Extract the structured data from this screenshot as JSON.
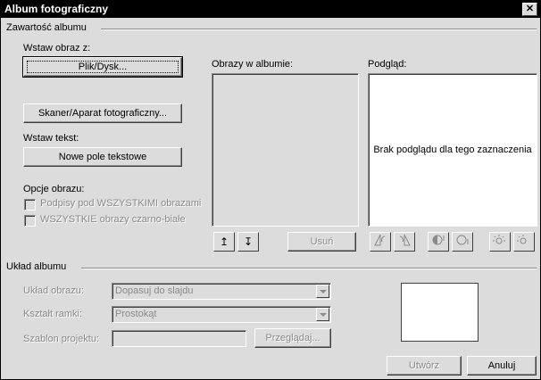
{
  "window": {
    "title": "Album fotograficzny"
  },
  "album_content": {
    "group_title": "Zawartość albumu",
    "insert_picture_label": "Wstaw obraz z:",
    "file_disk_button": "Plik/Dysk...",
    "scanner_button": "Skaner/Aparat fotograficzny...",
    "insert_text_label": "Wstaw tekst:",
    "new_textbox_button": "Nowe pole tekstowe",
    "picture_options_label": "Opcje obrazu:",
    "captions_checkbox": "Podpisy pod WSZYSTKIMI obrazami",
    "bw_checkbox": "WSZYSTKIE obrazy czarno-białe",
    "pictures_in_album_label": "Obrazy w albumie:",
    "move_up_glyph": "↥",
    "move_down_glyph": "↧",
    "remove_button": "Usuń",
    "preview_label": "Podgląd:",
    "preview_empty_text": "Brak podglądu dla tego zaznaczenia"
  },
  "album_layout": {
    "group_title": "Układ albumu",
    "picture_layout_label": "Układ obrazu:",
    "picture_layout_value": "Dopasuj do slajdu",
    "frame_shape_label": "Kształt ramki:",
    "frame_shape_value": "Prostokąt",
    "design_template_label": "Szablon projektu:",
    "design_template_value": "",
    "browse_button": "Przeglądaj..."
  },
  "footer": {
    "create_button": "Utwórz",
    "cancel_button": "Anuluj"
  },
  "icons": {
    "rotate_left": "rotate-left-icon",
    "rotate_right": "rotate-right-icon",
    "contrast_more": "contrast-more-icon",
    "contrast_less": "contrast-less-icon",
    "brightness_more": "brightness-more-icon",
    "brightness_less": "brightness-less-icon"
  }
}
